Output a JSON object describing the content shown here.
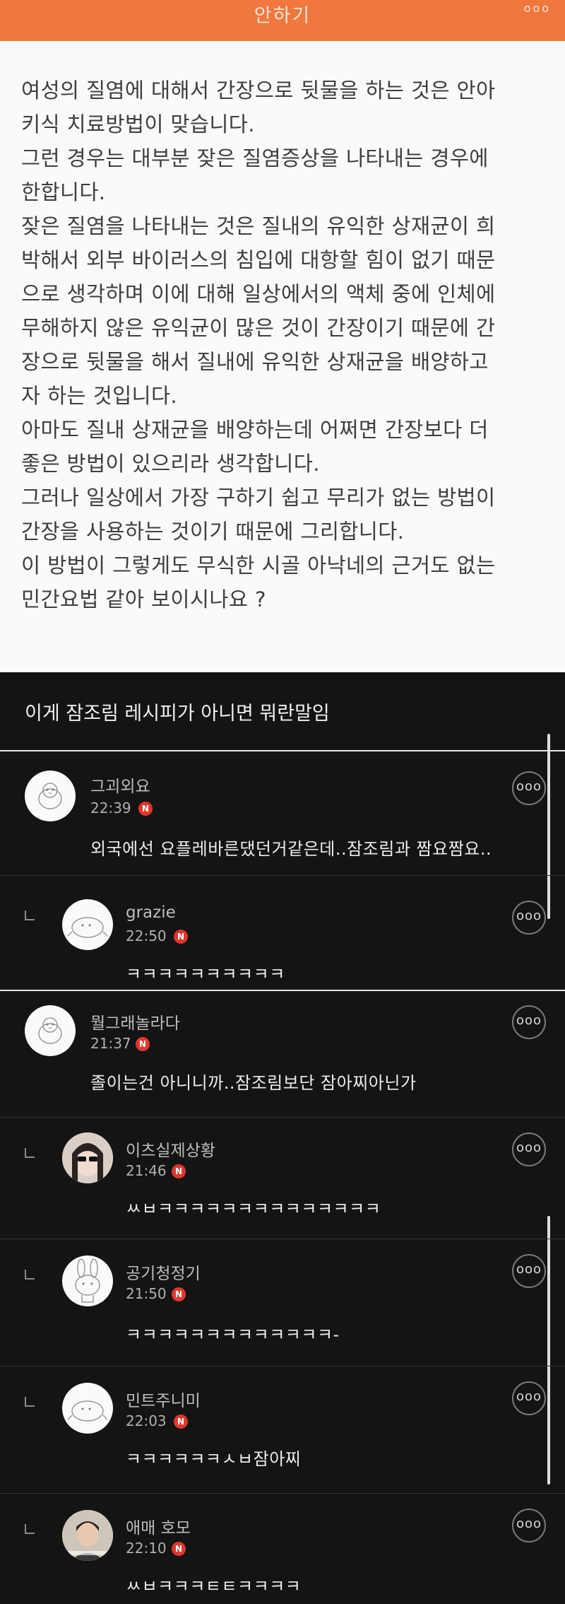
{
  "topbar": {
    "title": "안하기",
    "more_icon": "ooo"
  },
  "article": {
    "lines": [
      "여성의 질염에 대해서 간장으로 뒷물을 하는 것은 안아",
      "키식 치료방법이 맞습니다.",
      "그런 경우는 대부분 잦은 질염증상을 나타내는 경우에",
      "한합니다.",
      "잦은 질염을 나타내는 것은 질내의 유익한 상재균이 희",
      "박해서 외부 바이러스의 침입에 대항할 힘이 없기 때문",
      "으로 생각하며 이에 대해 일상에서의 액체 중에 인체에",
      "무해하지 않은 유익균이 많은 것이 간장이기 때문에 간",
      "장으로 뒷물을 해서 질내에 유익한 상재균을 배양하고",
      "자 하는 것입니다.",
      "아마도 질내 상재균을 배양하는데 어쩌면 간장보다 더",
      "좋은 방법이 있으리라 생각합니다.",
      "그러나 일상에서 가장 구하기 쉽고 무리가 없는 방법이",
      "간장을 사용하는 것이기 때문에 그리합니다.",
      "이 방법이 그렇게도 무식한 시골 아낙네의 근거도 없는",
      "민간요법 같아 보이시나요 ?"
    ]
  },
  "post": {
    "title": "이게 잠조림 레시피가 아니면 뭐란말임"
  },
  "comments": [
    {
      "name": "그괴외요",
      "time": "22:39",
      "badge": "N",
      "text": "외국에선 요플레바른댔던거같은데..잠조림과 짬요짬요..",
      "reply": false,
      "avatar": "duck"
    },
    {
      "name": "grazie",
      "time": "22:50",
      "badge": "N",
      "text": "ㅋㅋㅋㅋㅋㅋㅋㅋㅋㅋ",
      "reply": true,
      "avatar": "seal"
    },
    {
      "name": "뭘그래놀라다",
      "time": "21:37",
      "badge": "N",
      "text": "졸이는건 아니니까..잠조림보단 잠아찌아닌가",
      "reply": false,
      "avatar": "duck"
    },
    {
      "name": "이츠실제상황",
      "time": "21:46",
      "badge": "N",
      "text": "ㅆㅂㅋㅋㅋㅋㅋㅋㅋㅋㅋㅋㅋㅋㅋㅋ",
      "reply": true,
      "avatar": "girl"
    },
    {
      "name": "공기청정기",
      "time": "21:50",
      "badge": "N",
      "text": "ㅋㅋㅋㅋㅋㅋㅋㅋㅋㅋㅋㅋㅋ-",
      "reply": true,
      "avatar": "bunny"
    },
    {
      "name": "민트주니미",
      "time": "22:03",
      "badge": "N",
      "text": "ㅋㅋㅋㅋㅋㅋㅅㅂ잠아찌",
      "reply": true,
      "avatar": "seal"
    },
    {
      "name": "애매 호모",
      "time": "22:10",
      "badge": "N",
      "text": "ㅆㅂㅋㅋㅋㅌㅌㅋㅋㅋㅋ",
      "reply": true,
      "avatar": "person"
    }
  ],
  "menu_icon": "ooo",
  "colors": {
    "brand_orange": "#f0773d",
    "badge_red": "#e0372c",
    "dark_bg": "#141414"
  }
}
